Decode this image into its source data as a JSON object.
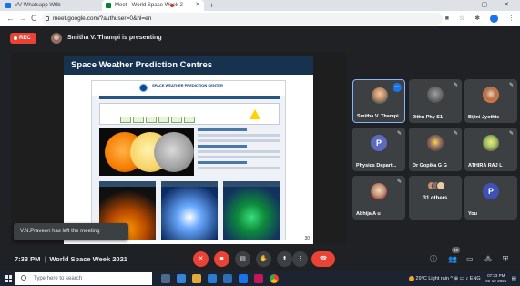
{
  "browser": {
    "tabs": [
      {
        "title": "VV Whatsapp Web",
        "active": false
      },
      {
        "title": "Meet - World Space Week 2",
        "active": true
      }
    ],
    "new_tab": "+",
    "window_controls": "— ▢ ✕",
    "url": "meet.google.com/?authuser=0&hl=en"
  },
  "meet": {
    "recording_label": "REC",
    "presenting_text": "Smitha V. Thampi is presenting",
    "slide": {
      "title": "Space Weather Prediction Centres",
      "page_number": "30",
      "website_title": "SPACE WEATHER PREDICTION CENTER"
    },
    "toast": "V.N.Praveen has left the meeting",
    "participants": [
      {
        "name": "Smitha V. Thampi",
        "type": "image",
        "speaking": true
      },
      {
        "name": "Jithu Phy S1",
        "type": "image",
        "speaking": false
      },
      {
        "name": "Bijini Jyothis",
        "type": "image",
        "speaking": false
      },
      {
        "name": "Physics Depart...",
        "type": "letter",
        "letter": "P",
        "speaking": false
      },
      {
        "name": "Dr Gopika G G",
        "type": "image",
        "speaking": false
      },
      {
        "name": "ATHIRA RAJ L",
        "type": "image",
        "speaking": false
      },
      {
        "name": "Abhija A u",
        "type": "image",
        "speaking": false
      },
      {
        "name": "31 others",
        "type": "others",
        "speaking": false
      },
      {
        "name": "You",
        "type": "letter",
        "letter": "P",
        "speaking": false
      }
    ],
    "time": "7:33 PM",
    "meeting_name": "World Space Week 2021",
    "people_count": "40"
  },
  "taskbar": {
    "search_placeholder": "Type here to search",
    "weather": "29°C  Light rain",
    "language": "ENG",
    "time": "07:33 PM",
    "date": "06-10-2021"
  },
  "colors": {
    "accent_red": "#ea4335",
    "meet_bg": "#202124",
    "tile_bg": "#3c4043",
    "speaking_blue": "#1a73e8"
  }
}
